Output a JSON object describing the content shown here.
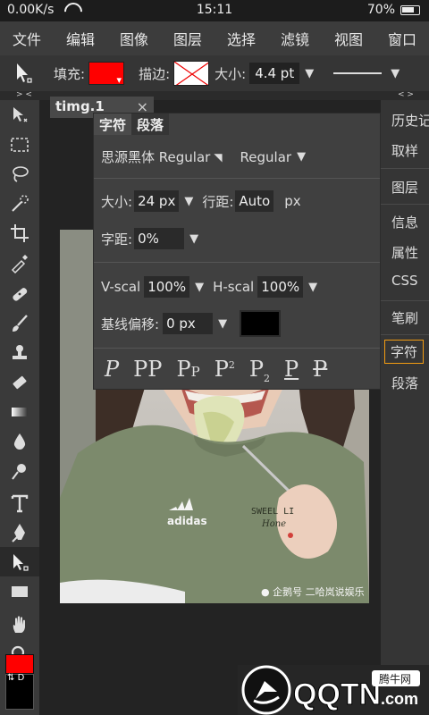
{
  "status_bar": {
    "network_speed": "0.00K/s",
    "time": "15:11",
    "battery_percent": "70%"
  },
  "menu": {
    "items": [
      "文件",
      "编辑",
      "图像",
      "图层",
      "选择",
      "滤镜",
      "视图",
      "窗口"
    ]
  },
  "options_bar": {
    "fill_label": "填充:",
    "fill_color": "#ff0000",
    "stroke_label": "描边:",
    "size_label": "大小:",
    "size_value": "4.4 pt"
  },
  "subbar": {
    "left_collapse": "> <",
    "right_collapse": "< >"
  },
  "document_tab": {
    "title": "timg.1",
    "close": "×"
  },
  "character_panel": {
    "tabs": [
      "字符",
      "段落"
    ],
    "font_family": "思源黑体 Regular",
    "font_style": "Regular",
    "size_label": "大小:",
    "size_value": "24 px",
    "leading_label": "行距:",
    "leading_value": "Auto",
    "leading_unit": "px",
    "tracking_label": "字距:",
    "tracking_value": "0%",
    "vscale_label": "V-scal",
    "vscale_value": "100%",
    "hscale_label": "H-scal",
    "hscale_value": "100%",
    "baseline_label": "基线偏移:",
    "baseline_value": "0 px",
    "text_color": "#000000",
    "style_buttons": [
      "P",
      "PP",
      "P",
      "P",
      "P",
      "P",
      "P"
    ],
    "style_button_suffixes": [
      "",
      "",
      "P",
      "2",
      "2",
      "",
      ""
    ]
  },
  "right_panel": {
    "items": [
      "历史记录",
      "取样",
      "图层",
      "信息",
      "属性",
      "CSS",
      "笔刷",
      "字符",
      "段落"
    ],
    "active": "字符"
  },
  "color_swatches": {
    "foreground": "#ff0000",
    "background": "#000000",
    "swap_label": "D"
  },
  "photo": {
    "shirt_brand": "adidas",
    "shirt_text_1": "SWEEL LI",
    "shirt_text_2": "Hone",
    "watermark": "企鹅号 二哈岚说娱乐"
  },
  "logo": {
    "brand": "QQTN",
    "domain": ".com",
    "tagline": "腾牛网"
  }
}
